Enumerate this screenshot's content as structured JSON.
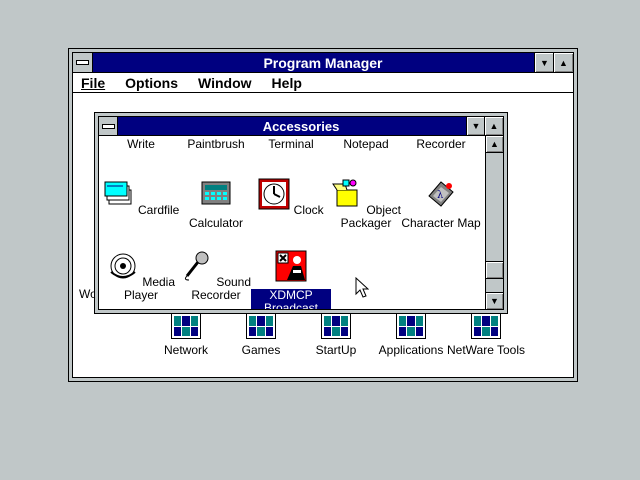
{
  "program_manager": {
    "title": "Program Manager",
    "menu": [
      "File",
      "Options",
      "Window",
      "Help"
    ],
    "groups": [
      "Network",
      "Games",
      "StartUp",
      "Applications",
      "NetWare Tools"
    ],
    "partial_label": "Wo"
  },
  "accessories": {
    "title": "Accessories",
    "top_row": [
      "Write",
      "Paintbrush",
      "Terminal",
      "Notepad",
      "Recorder"
    ],
    "row2": [
      "Cardfile",
      "Calculator",
      "Clock",
      "Object Packager",
      "Character Map"
    ],
    "row3": [
      "Media Player",
      "Sound Recorder",
      "XDMCP Broadcast"
    ]
  },
  "colors": {
    "desktop": "#c0c7c8",
    "titlebar": "#000080",
    "teal": "#008080"
  }
}
